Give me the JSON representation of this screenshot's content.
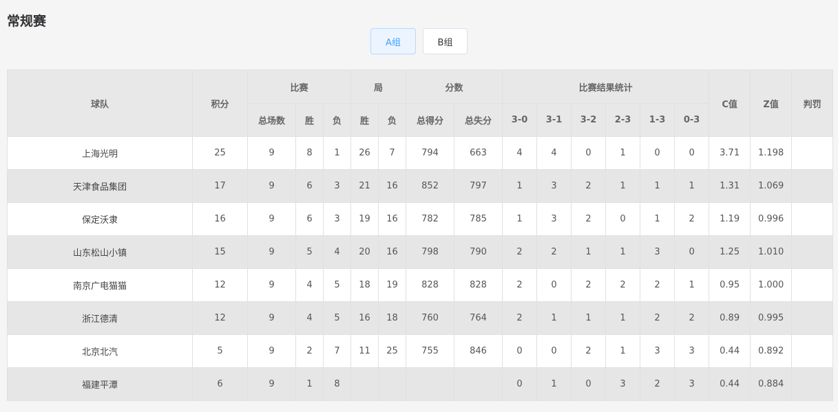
{
  "page": {
    "title": "常规赛"
  },
  "tabs": [
    {
      "label": "A组",
      "active": true
    },
    {
      "label": "B组",
      "active": false
    }
  ],
  "table": {
    "headers": {
      "team": "球队",
      "points": "积分",
      "match": "比赛",
      "match_sub": [
        "总场数",
        "胜",
        "负"
      ],
      "sets": "局",
      "sets_sub": [
        "胜",
        "负"
      ],
      "score": "分数",
      "score_sub": [
        "总得分",
        "总失分"
      ],
      "results": "比赛结果统计",
      "results_sub": [
        "3-0",
        "3-1",
        "3-2",
        "2-3",
        "1-3",
        "0-3"
      ],
      "c": "C值",
      "z": "Z值",
      "penalty": "判罚"
    },
    "rows": [
      [
        "上海光明",
        "25",
        "9",
        "8",
        "1",
        "26",
        "7",
        "794",
        "663",
        "4",
        "4",
        "0",
        "1",
        "0",
        "0",
        "3.71",
        "1.198",
        ""
      ],
      [
        "天津食品集团",
        "17",
        "9",
        "6",
        "3",
        "21",
        "16",
        "852",
        "797",
        "1",
        "3",
        "2",
        "1",
        "1",
        "1",
        "1.31",
        "1.069",
        ""
      ],
      [
        "保定沃隶",
        "16",
        "9",
        "6",
        "3",
        "19",
        "16",
        "782",
        "785",
        "1",
        "3",
        "2",
        "0",
        "1",
        "2",
        "1.19",
        "0.996",
        ""
      ],
      [
        "山东松山小镇",
        "15",
        "9",
        "5",
        "4",
        "20",
        "16",
        "798",
        "790",
        "2",
        "2",
        "1",
        "1",
        "3",
        "0",
        "1.25",
        "1.010",
        ""
      ],
      [
        "南京广电猫猫",
        "12",
        "9",
        "4",
        "5",
        "18",
        "19",
        "828",
        "828",
        "2",
        "0",
        "2",
        "2",
        "2",
        "1",
        "0.95",
        "1.000",
        ""
      ],
      [
        "浙江德清",
        "12",
        "9",
        "4",
        "5",
        "16",
        "18",
        "760",
        "764",
        "2",
        "1",
        "1",
        "1",
        "2",
        "2",
        "0.89",
        "0.995",
        ""
      ],
      [
        "北京北汽",
        "5",
        "9",
        "2",
        "7",
        "11",
        "25",
        "755",
        "846",
        "0",
        "0",
        "2",
        "1",
        "3",
        "3",
        "0.44",
        "0.892",
        ""
      ],
      [
        "福建平潭",
        "6",
        "9",
        "1",
        "8",
        "",
        "",
        "",
        "",
        "0",
        "1",
        "0",
        "3",
        "2",
        "3",
        "0.44",
        "0.884",
        ""
      ]
    ]
  }
}
